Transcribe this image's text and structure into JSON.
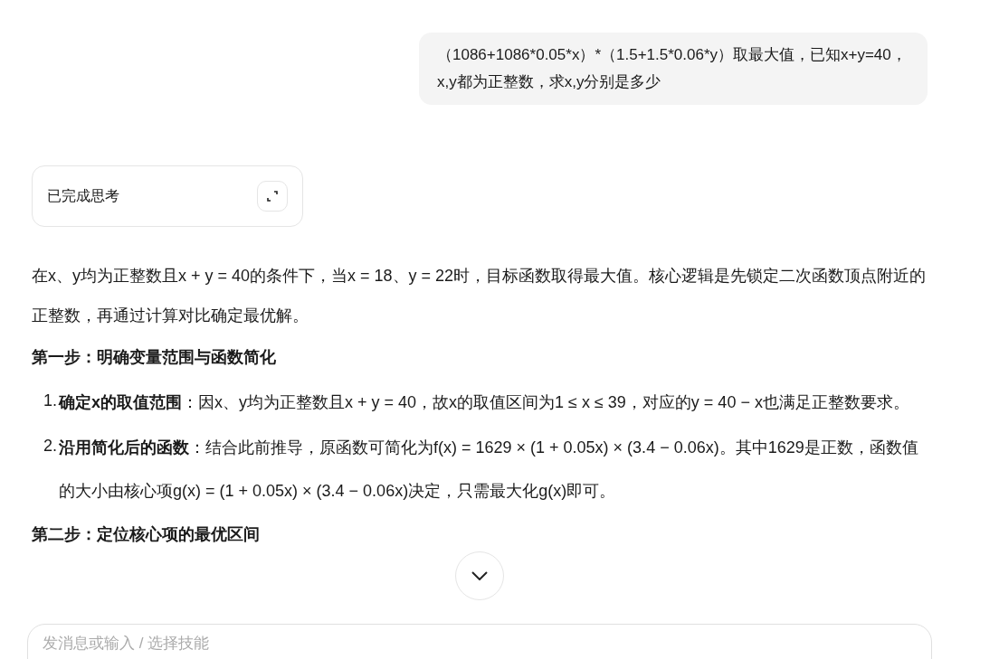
{
  "user_message": {
    "text": "（1086+1086*0.05*x）*（1.5+1.5*0.06*y）取最大值，已知x+y=40，x,y都为正整数，求x,y分别是多少"
  },
  "thinking": {
    "label": "已完成思考",
    "expanded": false
  },
  "answer": {
    "intro": "在x、y均为正整数且x + y = 40的条件下，当x = 18、y = 22时，目标函数取得最大值。核心逻辑是先锁定二次函数顶点附近的正整数，再通过计算对比确定最优解。",
    "sections": [
      {
        "heading": "第一步：明确变量范围与函数简化",
        "items": [
          {
            "marker": "1.",
            "text": "**确定x的取值范围**：因x、y均为正整数且x + y = 40，故x的取值区间为1 ≤ x ≤ 39，对应的y = 40 − x也满足正整数要求。"
          },
          {
            "marker": "2.",
            "text": "**沿用简化后的函数**：结合此前推导，原函数可简化为f(x) = 1629 × (1 + 0.05x) × (3.4 − 0.06x)。其中1629是正数，函数值的大小由核心项g(x) = (1 + 0.05x) × (3.4 − 0.06x)决定，只需最大化g(x)即可。"
          }
        ]
      },
      {
        "heading": "第二步：定位核心项的最优区间"
      }
    ]
  },
  "input": {
    "placeholder": "发消息或输入 / 选择技能"
  }
}
